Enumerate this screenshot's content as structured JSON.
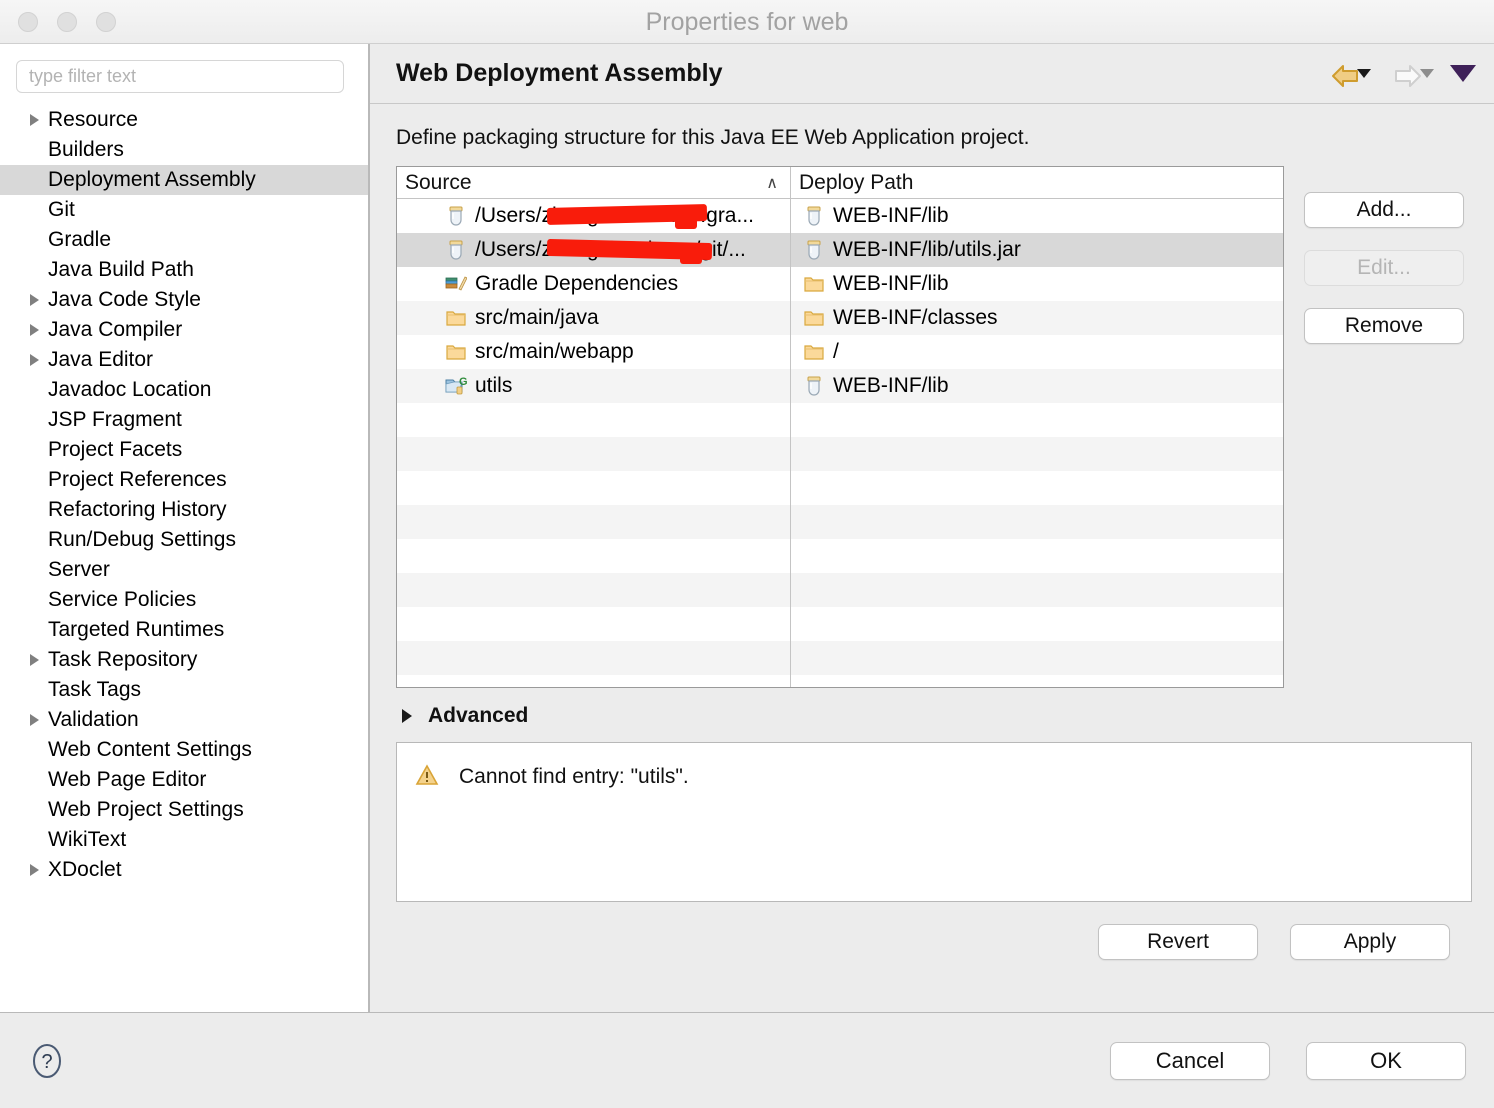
{
  "window": {
    "title": "Properties for web",
    "traffic_lights": [
      "close",
      "minimize",
      "maximize"
    ]
  },
  "sidebar": {
    "filter": {
      "value": "",
      "placeholder": "type filter text"
    },
    "items": [
      {
        "label": "Resource",
        "expandable": true,
        "selected": false
      },
      {
        "label": "Builders",
        "expandable": false,
        "selected": false
      },
      {
        "label": "Deployment Assembly",
        "expandable": false,
        "selected": true
      },
      {
        "label": "Git",
        "expandable": false,
        "selected": false
      },
      {
        "label": "Gradle",
        "expandable": false,
        "selected": false
      },
      {
        "label": "Java Build Path",
        "expandable": false,
        "selected": false
      },
      {
        "label": "Java Code Style",
        "expandable": true,
        "selected": false
      },
      {
        "label": "Java Compiler",
        "expandable": true,
        "selected": false
      },
      {
        "label": "Java Editor",
        "expandable": true,
        "selected": false
      },
      {
        "label": "Javadoc Location",
        "expandable": false,
        "selected": false
      },
      {
        "label": "JSP Fragment",
        "expandable": false,
        "selected": false
      },
      {
        "label": "Project Facets",
        "expandable": false,
        "selected": false
      },
      {
        "label": "Project References",
        "expandable": false,
        "selected": false
      },
      {
        "label": "Refactoring History",
        "expandable": false,
        "selected": false
      },
      {
        "label": "Run/Debug Settings",
        "expandable": false,
        "selected": false
      },
      {
        "label": "Server",
        "expandable": false,
        "selected": false
      },
      {
        "label": "Service Policies",
        "expandable": false,
        "selected": false
      },
      {
        "label": "Targeted Runtimes",
        "expandable": false,
        "selected": false
      },
      {
        "label": "Task Repository",
        "expandable": true,
        "selected": false
      },
      {
        "label": "Task Tags",
        "expandable": false,
        "selected": false
      },
      {
        "label": "Validation",
        "expandable": true,
        "selected": false
      },
      {
        "label": "Web Content Settings",
        "expandable": false,
        "selected": false
      },
      {
        "label": "Web Page Editor",
        "expandable": false,
        "selected": false
      },
      {
        "label": "Web Project Settings",
        "expandable": false,
        "selected": false
      },
      {
        "label": "WikiText",
        "expandable": false,
        "selected": false
      },
      {
        "label": "XDoclet",
        "expandable": true,
        "selected": false
      }
    ]
  },
  "main": {
    "page_title": "Web Deployment Assembly",
    "description": "Define packaging structure for this Java EE Web Application project.",
    "nav": {
      "back_icon": "back-arrow-icon",
      "back_menu_icon": "chevron-down-icon",
      "forward_icon": "forward-arrow-icon",
      "forward_menu_icon": "chevron-down-icon",
      "overflow_icon": "chevron-down-large-icon",
      "back_enabled": true,
      "forward_enabled": false
    },
    "table": {
      "columns": [
        {
          "label": "Source",
          "sort": "asc",
          "sort_glyph": "∧"
        },
        {
          "label": "Deploy Path",
          "sort": "none",
          "sort_glyph": ""
        }
      ],
      "rows": [
        {
          "source": "/Users/zhangxiansheng/.gra...",
          "source_icon": "jar-icon",
          "source_redacted": true,
          "deploy": "WEB-INF/lib",
          "deploy_icon": "jar-icon",
          "selected": false
        },
        {
          "source": "/Users/zhangxiansheng/git/...",
          "source_icon": "jar-icon",
          "source_redacted": true,
          "deploy": "WEB-INF/lib/utils.jar",
          "deploy_icon": "jar-icon",
          "selected": true
        },
        {
          "source": "Gradle Dependencies",
          "source_icon": "library-books-icon",
          "source_redacted": false,
          "deploy": "WEB-INF/lib",
          "deploy_icon": "folder-icon",
          "selected": false
        },
        {
          "source": "src/main/java",
          "source_icon": "folder-icon",
          "source_redacted": false,
          "deploy": "WEB-INF/classes",
          "deploy_icon": "folder-icon",
          "selected": false
        },
        {
          "source": "src/main/webapp",
          "source_icon": "folder-icon",
          "source_redacted": false,
          "deploy": "/",
          "deploy_icon": "folder-icon",
          "selected": false
        },
        {
          "source": "utils",
          "source_icon": "gradle-project-icon",
          "source_redacted": false,
          "deploy": "WEB-INF/lib",
          "deploy_icon": "jar-icon",
          "selected": false
        }
      ],
      "empty_row_count": 9
    },
    "side_buttons": [
      {
        "label": "Add...",
        "enabled": true
      },
      {
        "label": "Edit...",
        "enabled": false
      },
      {
        "label": "Remove",
        "enabled": true
      }
    ],
    "advanced": {
      "label": "Advanced",
      "expanded": false,
      "arrow_icon": "chevron-right-icon"
    },
    "message": {
      "icon": "warning-triangle-icon",
      "text": "Cannot find entry: \"utils\"."
    },
    "apply_buttons": [
      {
        "label": "Revert",
        "enabled": true
      },
      {
        "label": "Apply",
        "enabled": true
      }
    ]
  },
  "footer": {
    "help_icon": "help-question-icon",
    "buttons": [
      {
        "label": "Cancel",
        "enabled": true
      },
      {
        "label": "OK",
        "enabled": true,
        "default": true
      }
    ]
  },
  "colors": {
    "window_bg": "#ececec",
    "pane_bg": "#ffffff",
    "selection": "#d8d8d8",
    "row_stripe": "#f4f4f4",
    "redaction": "#f91c0b",
    "back_arrow": "#d9a437",
    "overflow_caret": "#3f2159",
    "warning": "#e8b84b",
    "folder": "#f7d18a"
  }
}
